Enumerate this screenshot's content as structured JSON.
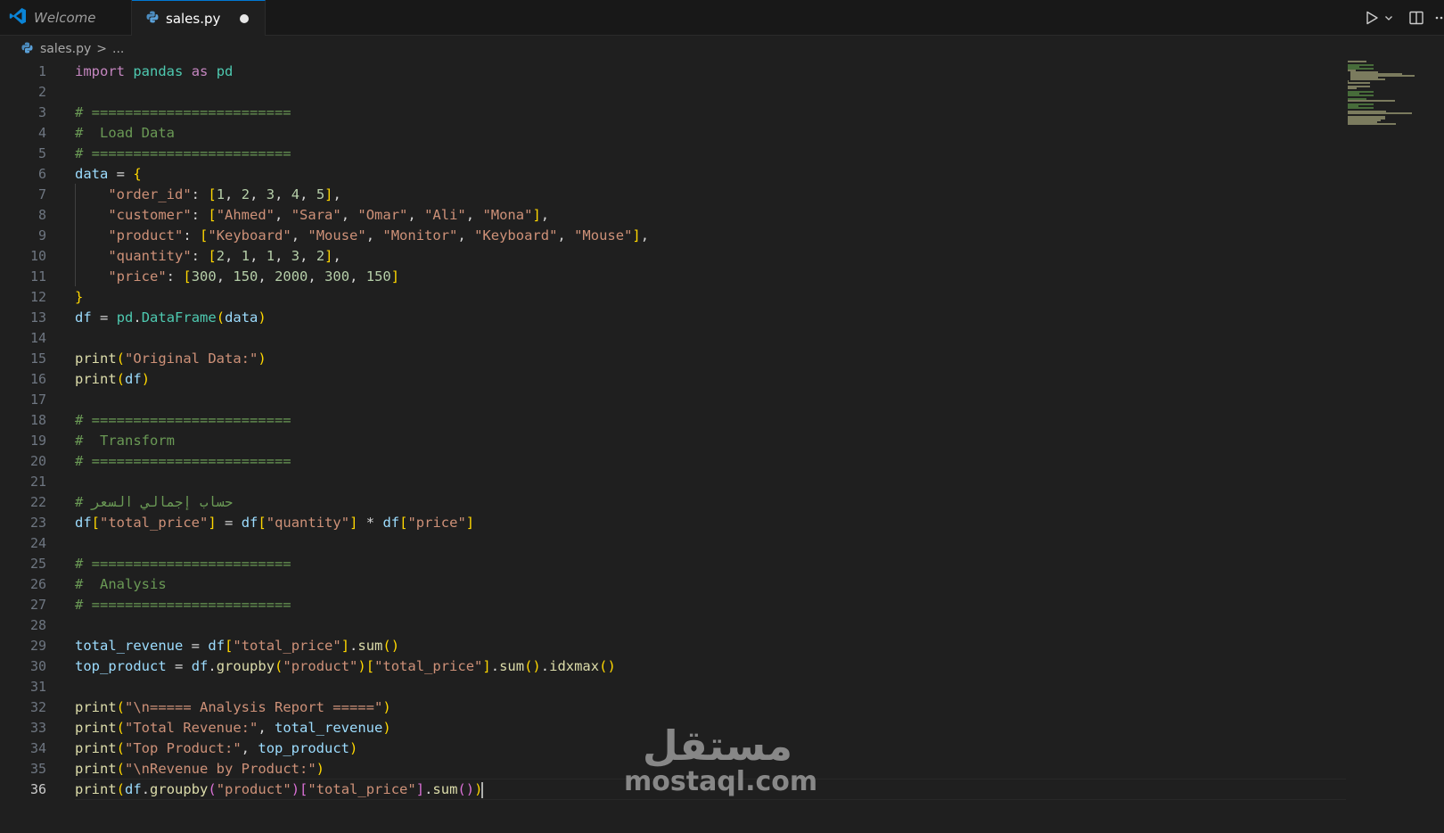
{
  "tabs": [
    {
      "label": "Welcome",
      "icon": "vscode-logo-icon",
      "active": false
    },
    {
      "label": "sales.py",
      "icon": "python-file-icon",
      "active": true,
      "dirty": true
    }
  ],
  "actions": [
    "run-icon",
    "chevron-down-icon",
    "split-editor-icon",
    "more-icon"
  ],
  "breadcrumb": {
    "file": "sales.py",
    "separator": ">",
    "rest": "..."
  },
  "editor": {
    "active_line": 36,
    "lines": [
      "import pandas as pd",
      "",
      "# ========================",
      "#  Load Data",
      "# ========================",
      "data = {",
      "    \"order_id\": [1, 2, 3, 4, 5],",
      "    \"customer\": [\"Ahmed\", \"Sara\", \"Omar\", \"Ali\", \"Mona\"],",
      "    \"product\": [\"Keyboard\", \"Mouse\", \"Monitor\", \"Keyboard\", \"Mouse\"],",
      "    \"quantity\": [2, 1, 1, 3, 2],",
      "    \"price\": [300, 150, 2000, 300, 150]",
      "}",
      "df = pd.DataFrame(data)",
      "",
      "print(\"Original Data:\")",
      "print(df)",
      "",
      "# ========================",
      "#  Transform",
      "# ========================",
      "",
      "# حساب إجمالي السعر",
      "df[\"total_price\"] = df[\"quantity\"] * df[\"price\"]",
      "",
      "# ========================",
      "#  Analysis",
      "# ========================",
      "",
      "total_revenue = df[\"total_price\"].sum()",
      "top_product = df.groupby(\"product\")[\"total_price\"].sum().idxmax()",
      "",
      "print(\"\\n===== Analysis Report =====\")",
      "print(\"Total Revenue:\", total_revenue)",
      "print(\"Top Product:\", top_product)",
      "print(\"\\nRevenue by Product:\")",
      "print(df.groupby(\"product\")[\"total_price\"].sum())"
    ]
  },
  "watermark": {
    "arabic": "مستقل",
    "latin": "mostaql.com"
  },
  "colors": {
    "background": "#1f1f1f",
    "keyword": "#c586c0",
    "module": "#4ec9b0",
    "variable": "#9cdcfe",
    "function": "#dcdcaa",
    "string": "#ce9178",
    "number": "#b5cea8",
    "comment": "#6a9955"
  }
}
